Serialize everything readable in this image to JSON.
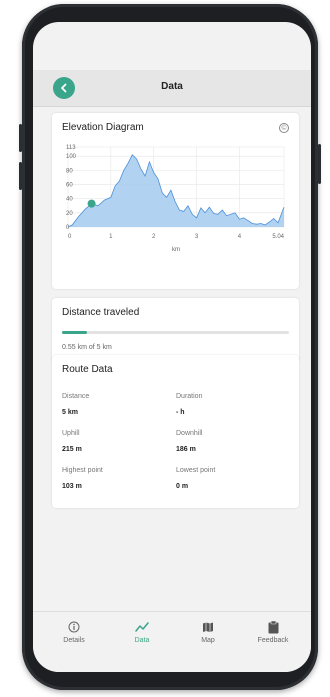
{
  "header": {
    "title": "Data",
    "back_icon": "chevron-left-icon",
    "accent": "#3aa58a"
  },
  "elevation": {
    "title": "Elevation Diagram",
    "help_icon": "help-circle-icon",
    "help_glyph": "©",
    "chart_data": {
      "type": "area",
      "xlabel": "km",
      "ylabel": "",
      "xlim": [
        0,
        5.04
      ],
      "ylim": [
        0,
        113
      ],
      "x_ticks": [
        "0",
        "1",
        "2",
        "3",
        "4",
        "5.04"
      ],
      "x_tick_values": [
        0,
        1,
        2,
        3,
        4,
        5.04
      ],
      "y_ticks": [
        "0",
        "20",
        "40",
        "60",
        "80",
        "100",
        "113"
      ],
      "y_tick_values": [
        0,
        20,
        40,
        60,
        80,
        100,
        113
      ],
      "grid": true,
      "fill_color": "#a9cdee",
      "line_color": "#4a90d9",
      "marker": {
        "x": 0.55,
        "y": 33,
        "color": "#3aa58a"
      },
      "x": [
        0,
        0.1,
        0.25,
        0.4,
        0.55,
        0.7,
        0.85,
        1.0,
        1.1,
        1.2,
        1.3,
        1.4,
        1.5,
        1.6,
        1.7,
        1.8,
        1.9,
        2.0,
        2.1,
        2.2,
        2.3,
        2.4,
        2.5,
        2.6,
        2.7,
        2.8,
        2.9,
        3.0,
        3.1,
        3.2,
        3.3,
        3.4,
        3.5,
        3.6,
        3.7,
        3.8,
        3.9,
        4.0,
        4.1,
        4.2,
        4.3,
        4.4,
        4.5,
        4.6,
        4.7,
        4.8,
        4.9,
        5.04
      ],
      "y": [
        0,
        3,
        15,
        25,
        33,
        30,
        38,
        42,
        58,
        65,
        80,
        90,
        102,
        96,
        82,
        72,
        92,
        77,
        68,
        48,
        42,
        52,
        36,
        24,
        22,
        30,
        18,
        13,
        27,
        20,
        28,
        19,
        18,
        24,
        16,
        18,
        20,
        11,
        13,
        9,
        5,
        4,
        5,
        3,
        7,
        12,
        6,
        28
      ]
    }
  },
  "distance": {
    "title": "Distance traveled",
    "progress_text": "0.55 km of 5 km",
    "progress_fraction": 0.11
  },
  "route": {
    "title": "Route Data",
    "items": [
      {
        "label": "Distance",
        "value": "5 km"
      },
      {
        "label": "Duration",
        "value": "- h"
      },
      {
        "label": "Uphill",
        "value": "215 m"
      },
      {
        "label": "Downhill",
        "value": "186 m"
      },
      {
        "label": "Highest point",
        "value": "103 m"
      },
      {
        "label": "Lowest point",
        "value": "0 m"
      }
    ]
  },
  "nav": {
    "items": [
      {
        "label": "Details",
        "icon": "info-icon",
        "active": false
      },
      {
        "label": "Data",
        "icon": "chart-line-icon",
        "active": true
      },
      {
        "label": "Map",
        "icon": "map-icon",
        "active": false
      },
      {
        "label": "Feedback",
        "icon": "clipboard-icon",
        "active": false
      }
    ]
  }
}
